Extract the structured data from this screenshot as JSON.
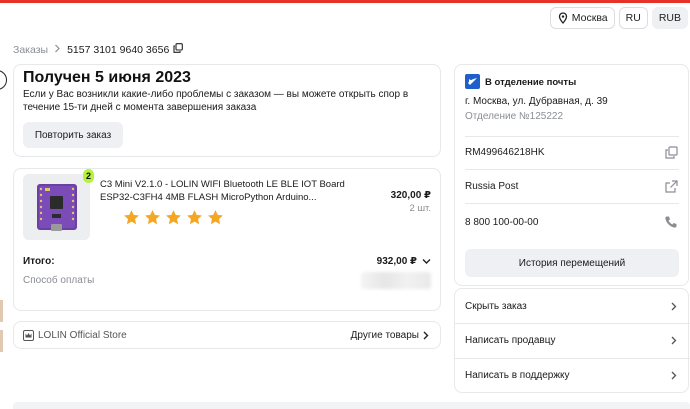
{
  "header": {
    "city": "Москва",
    "language": "RU",
    "currency": "RUB",
    "accent_color": "#e8302a"
  },
  "breadcrumb": {
    "root": "Заказы",
    "order_number": "5157 3101 9640 3656"
  },
  "status": {
    "title": "Получен 5 июня 2023",
    "subtitle": "Если у Вас возникли какие-либо проблемы с заказом — вы можете открыть спор в течение 15-ти дней с момента завершения заказа",
    "repeat_button": "Повторить заказ"
  },
  "product": {
    "quantity_badge": "2",
    "name": "C3 Mini V2.1.0 - LOLIN WIFI Bluetooth LE BLE IOT Board ESP32-C3FH4 4MB FLASH MicroPython Arduino...",
    "price": "320,00 ₽",
    "quantity": "2 шт.",
    "rating": 5,
    "star_color": "#f5a623"
  },
  "summary": {
    "total_label": "Итого:",
    "total_value": "932,00 ₽",
    "payment_label": "Способ оплаты"
  },
  "store": {
    "name": "LOLIN Official Store",
    "other_goods": "Другие товары"
  },
  "delivery": {
    "method": "В отделение почты",
    "address": "г. Москва, ул. Дубравная, д. 39",
    "office": "Отделение №125222",
    "tracking": "RM499646218HK",
    "carrier": "Russia Post",
    "phone": "8 800 100-00-00",
    "history_button": "История перемещений"
  },
  "actions": {
    "hide": "Скрыть заказ",
    "write_seller": "Написать продавцу",
    "write_support": "Написать в поддержку"
  }
}
